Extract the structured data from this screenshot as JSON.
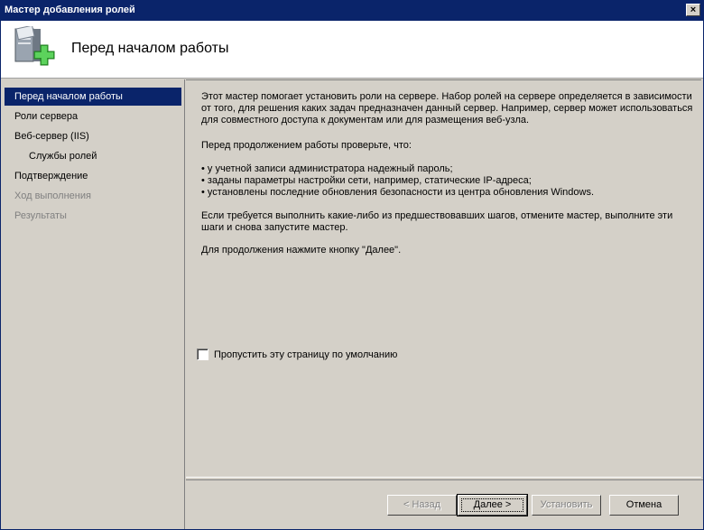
{
  "window": {
    "title": "Мастер добавления ролей",
    "close_glyph": "×"
  },
  "header": {
    "title": "Перед началом работы",
    "icon": "server-add-role-icon"
  },
  "nav": {
    "items": [
      {
        "label": "Перед началом работы",
        "state": "active"
      },
      {
        "label": "Роли сервера",
        "state": "normal"
      },
      {
        "label": "Веб-сервер (IIS)",
        "state": "normal"
      },
      {
        "label": "Службы ролей",
        "state": "normal"
      },
      {
        "label": "Подтверждение",
        "state": "normal"
      },
      {
        "label": "Ход выполнения",
        "state": "disabled"
      },
      {
        "label": "Результаты",
        "state": "disabled"
      }
    ]
  },
  "content": {
    "intro": "Этот мастер помогает установить роли на сервере. Набор ролей на сервере определяется в зависимости от того, для решения каких задач предназначен данный сервер. Например, сервер может использоваться для совместного доступа к документам или для размещения веб-узла.",
    "check_prompt": "Перед продолжением работы проверьте, что:",
    "bullets": [
      "у учетной записи администратора надежный пароль;",
      "заданы параметры настройки сети, например, статические IP-адреса;",
      "установлены последние обновления безопасности из центра обновления Windows."
    ],
    "cancel_hint": "Если требуется выполнить какие-либо из предшествовавших шагов, отмените мастер, выполните эти шаги и снова запустите мастер.",
    "continue_hint": "Для продолжения нажмите кнопку \"Далее\".",
    "skip_label": "Пропустить эту страницу по умолчанию",
    "skip_checked": false
  },
  "buttons": {
    "back": "< Назад",
    "next": "Далее >",
    "install": "Установить",
    "cancel": "Отмена"
  },
  "colors": {
    "titlebar": "#0a246a",
    "selection": "#0a246a",
    "face": "#d4d0c8"
  }
}
